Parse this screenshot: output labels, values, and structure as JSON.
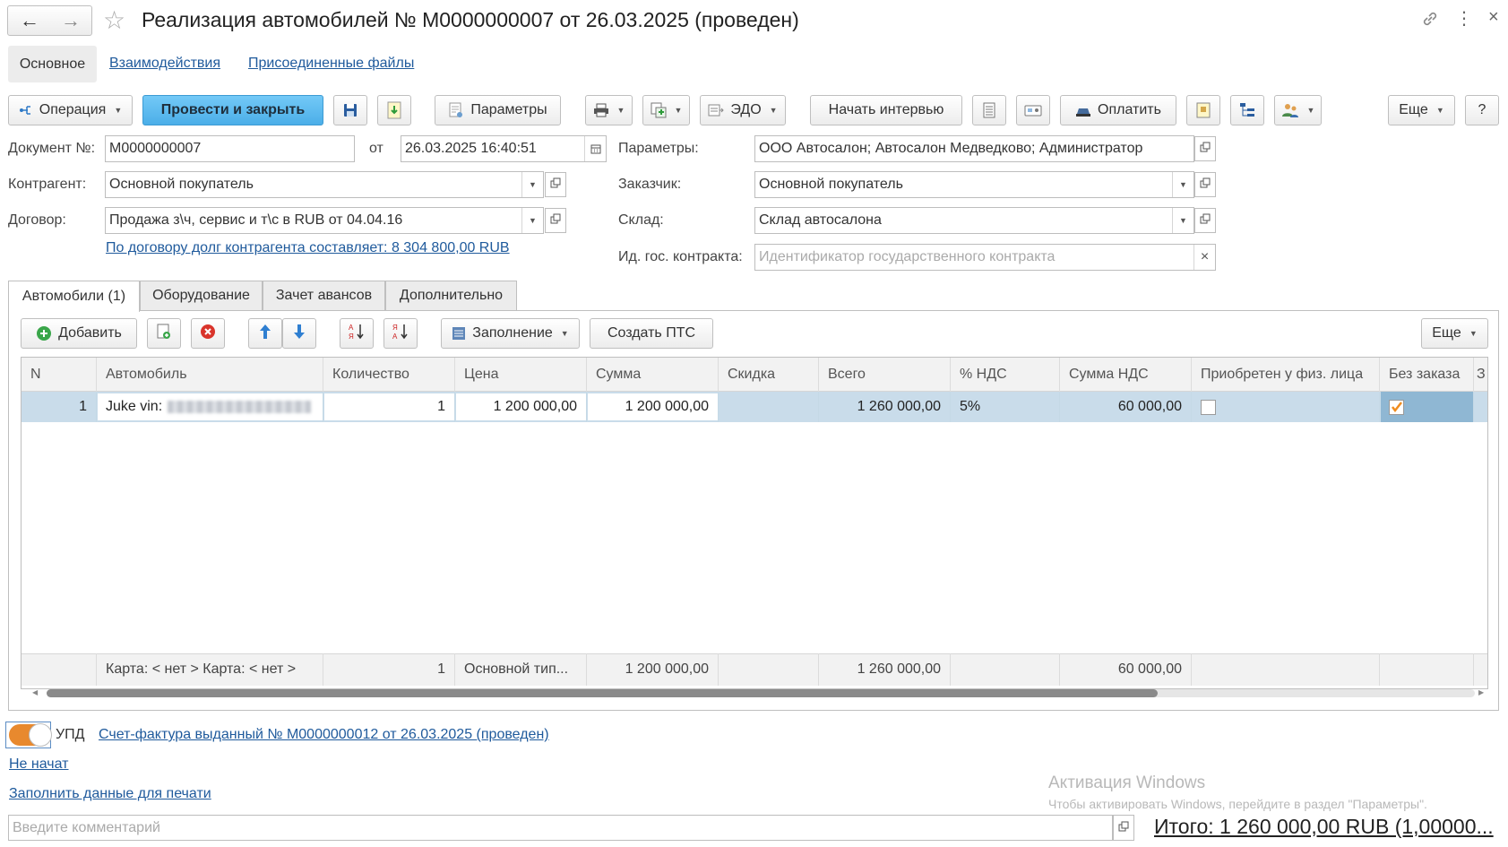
{
  "window": {
    "title": "Реализация автомобилей № М0000000007 от 26.03.2025 (проведен)"
  },
  "section_tabs": [
    "Основное",
    "Взаимодействия",
    "Присоединенные файлы"
  ],
  "toolbar": {
    "operation": "Операция",
    "post_close": "Провести и закрыть",
    "params": "Параметры",
    "edo": "ЭДО",
    "interview": "Начать интервью",
    "pay": "Оплатить",
    "more": "Еще",
    "help": "?"
  },
  "form": {
    "doc_no_label": "Документ №:",
    "doc_no": "М0000000007",
    "date_label": "от",
    "date": "26.03.2025 16:40:51",
    "params_label": "Параметры:",
    "params": "ООО Автосалон; Автосалон Медведково; Администратор",
    "contractor_label": "Контрагент:",
    "contractor": "Основной покупатель",
    "customer_label": "Заказчик:",
    "customer": "Основной покупатель",
    "contract_label": "Договор:",
    "contract": "Продажа з\\ч, сервис и т\\с в RUB от 04.04.16",
    "warehouse_label": "Склад:",
    "warehouse": "Склад автосалона",
    "debt_link": "По договору долг контрагента составляет: 8 304 800,00 RUB",
    "gov_label": "Ид. гос. контракта:",
    "gov_placeholder": "Идентификатор государственного контракта"
  },
  "content_tabs": [
    "Автомобили (1)",
    "Оборудование",
    "Зачет авансов",
    "Дополнительно"
  ],
  "table_toolbar": {
    "add": "Добавить",
    "fill": "Заполнение",
    "create_pts": "Создать ПТС",
    "more": "Еще"
  },
  "table": {
    "headers": [
      "N",
      "Автомобиль",
      "Количество",
      "Цена",
      "Сумма",
      "Скидка",
      "Всего",
      "% НДС",
      "Сумма НДС",
      "Приобретен у физ. лица",
      "Без заказа",
      "З"
    ],
    "rows": [
      {
        "n": "1",
        "car": "Juke vin:",
        "qty": "1",
        "price": "1 200 000,00",
        "sum": "1 200 000,00",
        "discount": "",
        "total": "1 260 000,00",
        "vat_rate": "5%",
        "vat_sum": "60 000,00",
        "from_person": false,
        "no_order": true
      }
    ],
    "footer": {
      "car": "Карта: < нет >  Карта: < нет >",
      "qty": "1",
      "price": "Основной тип...",
      "sum": "1 200 000,00",
      "total": "1 260 000,00",
      "vat_sum": "60 000,00"
    }
  },
  "bottom": {
    "upd_label": "УПД",
    "invoice_link": "Счет-фактура выданный № М0000000012 от 26.03.2025 (проведен)",
    "not_started": "Не начат",
    "fill_print": "Заполнить данные для печати",
    "comment_placeholder": "Введите комментарий",
    "total": "Итого: 1 260 000,00 RUB (1,00000..."
  },
  "watermark": {
    "title": "Активация Windows",
    "subtitle": "Чтобы активировать Windows, перейдите в раздел \"Параметры\"."
  },
  "colors": {
    "accent": "#4baee8",
    "selected_row": "#c9dcea",
    "link": "#1f5a9c",
    "toggle": "#e8892e",
    "checkbox": "#f08c1e"
  }
}
